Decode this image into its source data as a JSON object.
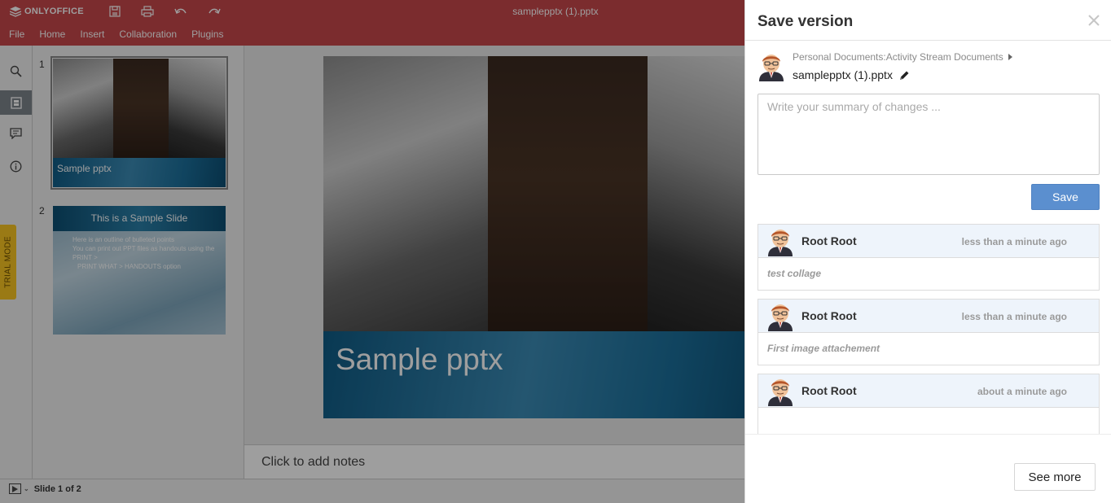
{
  "app": {
    "logo_text": "ONLYOFFICE",
    "document_title": "samplepptx (1).pptx",
    "accent_color": "#c7474b"
  },
  "toolbar": {
    "icons": [
      "save-icon",
      "print-icon",
      "undo-icon",
      "redo-icon"
    ]
  },
  "menu": {
    "items": [
      "File",
      "Home",
      "Insert",
      "Collaboration",
      "Plugins"
    ]
  },
  "left_rail": {
    "items": [
      "search-icon",
      "slides-icon",
      "comments-icon",
      "info-icon"
    ],
    "active": "slides-icon",
    "trial_label": "TRIAL MODE"
  },
  "thumbnails": {
    "slides": [
      {
        "number": "1",
        "caption": "Sample pptx"
      },
      {
        "number": "2",
        "title": "This is a Sample Slide",
        "bullets": [
          "Here is an outline of bulleted points",
          "You can print out PPT files as handouts using the",
          "PRINT >",
          "PRINT WHAT > HANDOUTS option"
        ]
      }
    ]
  },
  "slide": {
    "title": "Sample pptx"
  },
  "notes": {
    "placeholder": "Click to add notes"
  },
  "status": {
    "slide_counter": "Slide 1 of 2"
  },
  "panel": {
    "title": "Save version",
    "breadcrumb": "Personal Documents:Activity Stream Documents",
    "filename": "samplepptx (1).pptx",
    "summary_placeholder": "Write your summary of changes ...",
    "save_label": "Save",
    "see_more_label": "See more",
    "accent_color": "#5b8fcf",
    "versions": [
      {
        "author": "Root Root",
        "time": "less than a minute ago",
        "comment": "test collage"
      },
      {
        "author": "Root Root",
        "time": "less than a minute ago",
        "comment": "First image attachement"
      },
      {
        "author": "Root Root",
        "time": "about a minute ago",
        "comment": ""
      }
    ]
  }
}
